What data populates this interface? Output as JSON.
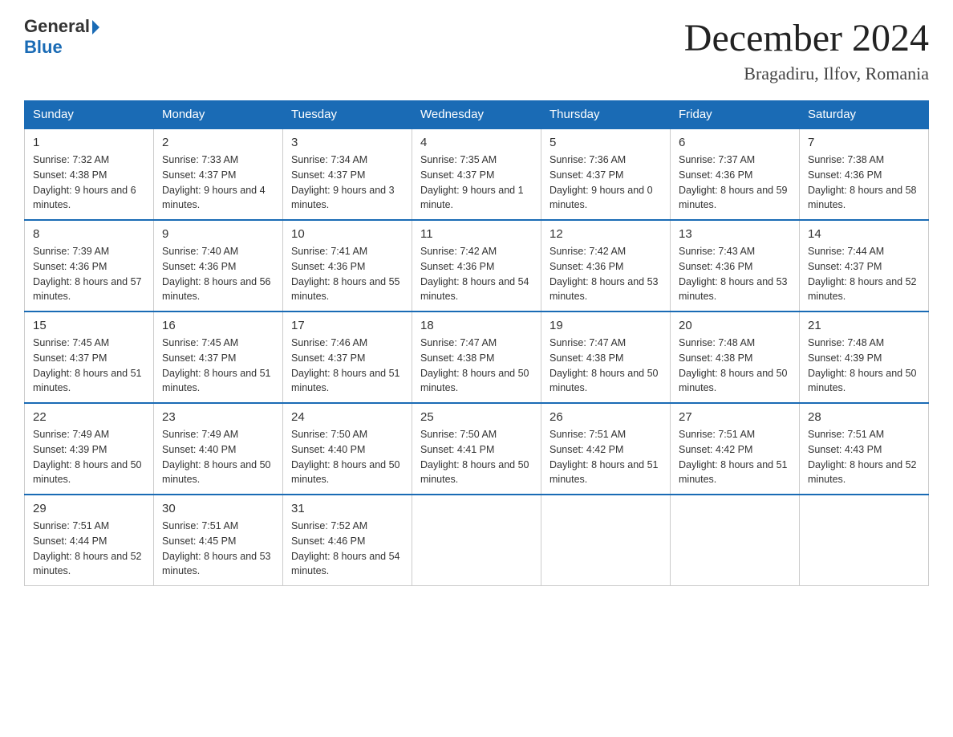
{
  "logo": {
    "text_general": "General",
    "text_blue": "Blue",
    "arrow_label": "logo-arrow"
  },
  "title": {
    "month": "December 2024",
    "location": "Bragadiru, Ilfov, Romania"
  },
  "weekdays": [
    "Sunday",
    "Monday",
    "Tuesday",
    "Wednesday",
    "Thursday",
    "Friday",
    "Saturday"
  ],
  "weeks": [
    [
      {
        "day": "1",
        "sunrise": "7:32 AM",
        "sunset": "4:38 PM",
        "daylight": "9 hours and 6 minutes."
      },
      {
        "day": "2",
        "sunrise": "7:33 AM",
        "sunset": "4:37 PM",
        "daylight": "9 hours and 4 minutes."
      },
      {
        "day": "3",
        "sunrise": "7:34 AM",
        "sunset": "4:37 PM",
        "daylight": "9 hours and 3 minutes."
      },
      {
        "day": "4",
        "sunrise": "7:35 AM",
        "sunset": "4:37 PM",
        "daylight": "9 hours and 1 minute."
      },
      {
        "day": "5",
        "sunrise": "7:36 AM",
        "sunset": "4:37 PM",
        "daylight": "9 hours and 0 minutes."
      },
      {
        "day": "6",
        "sunrise": "7:37 AM",
        "sunset": "4:36 PM",
        "daylight": "8 hours and 59 minutes."
      },
      {
        "day": "7",
        "sunrise": "7:38 AM",
        "sunset": "4:36 PM",
        "daylight": "8 hours and 58 minutes."
      }
    ],
    [
      {
        "day": "8",
        "sunrise": "7:39 AM",
        "sunset": "4:36 PM",
        "daylight": "8 hours and 57 minutes."
      },
      {
        "day": "9",
        "sunrise": "7:40 AM",
        "sunset": "4:36 PM",
        "daylight": "8 hours and 56 minutes."
      },
      {
        "day": "10",
        "sunrise": "7:41 AM",
        "sunset": "4:36 PM",
        "daylight": "8 hours and 55 minutes."
      },
      {
        "day": "11",
        "sunrise": "7:42 AM",
        "sunset": "4:36 PM",
        "daylight": "8 hours and 54 minutes."
      },
      {
        "day": "12",
        "sunrise": "7:42 AM",
        "sunset": "4:36 PM",
        "daylight": "8 hours and 53 minutes."
      },
      {
        "day": "13",
        "sunrise": "7:43 AM",
        "sunset": "4:36 PM",
        "daylight": "8 hours and 53 minutes."
      },
      {
        "day": "14",
        "sunrise": "7:44 AM",
        "sunset": "4:37 PM",
        "daylight": "8 hours and 52 minutes."
      }
    ],
    [
      {
        "day": "15",
        "sunrise": "7:45 AM",
        "sunset": "4:37 PM",
        "daylight": "8 hours and 51 minutes."
      },
      {
        "day": "16",
        "sunrise": "7:45 AM",
        "sunset": "4:37 PM",
        "daylight": "8 hours and 51 minutes."
      },
      {
        "day": "17",
        "sunrise": "7:46 AM",
        "sunset": "4:37 PM",
        "daylight": "8 hours and 51 minutes."
      },
      {
        "day": "18",
        "sunrise": "7:47 AM",
        "sunset": "4:38 PM",
        "daylight": "8 hours and 50 minutes."
      },
      {
        "day": "19",
        "sunrise": "7:47 AM",
        "sunset": "4:38 PM",
        "daylight": "8 hours and 50 minutes."
      },
      {
        "day": "20",
        "sunrise": "7:48 AM",
        "sunset": "4:38 PM",
        "daylight": "8 hours and 50 minutes."
      },
      {
        "day": "21",
        "sunrise": "7:48 AM",
        "sunset": "4:39 PM",
        "daylight": "8 hours and 50 minutes."
      }
    ],
    [
      {
        "day": "22",
        "sunrise": "7:49 AM",
        "sunset": "4:39 PM",
        "daylight": "8 hours and 50 minutes."
      },
      {
        "day": "23",
        "sunrise": "7:49 AM",
        "sunset": "4:40 PM",
        "daylight": "8 hours and 50 minutes."
      },
      {
        "day": "24",
        "sunrise": "7:50 AM",
        "sunset": "4:40 PM",
        "daylight": "8 hours and 50 minutes."
      },
      {
        "day": "25",
        "sunrise": "7:50 AM",
        "sunset": "4:41 PM",
        "daylight": "8 hours and 50 minutes."
      },
      {
        "day": "26",
        "sunrise": "7:51 AM",
        "sunset": "4:42 PM",
        "daylight": "8 hours and 51 minutes."
      },
      {
        "day": "27",
        "sunrise": "7:51 AM",
        "sunset": "4:42 PM",
        "daylight": "8 hours and 51 minutes."
      },
      {
        "day": "28",
        "sunrise": "7:51 AM",
        "sunset": "4:43 PM",
        "daylight": "8 hours and 52 minutes."
      }
    ],
    [
      {
        "day": "29",
        "sunrise": "7:51 AM",
        "sunset": "4:44 PM",
        "daylight": "8 hours and 52 minutes."
      },
      {
        "day": "30",
        "sunrise": "7:51 AM",
        "sunset": "4:45 PM",
        "daylight": "8 hours and 53 minutes."
      },
      {
        "day": "31",
        "sunrise": "7:52 AM",
        "sunset": "4:46 PM",
        "daylight": "8 hours and 54 minutes."
      },
      null,
      null,
      null,
      null
    ]
  ],
  "labels": {
    "sunrise": "Sunrise:",
    "sunset": "Sunset:",
    "daylight": "Daylight:"
  }
}
